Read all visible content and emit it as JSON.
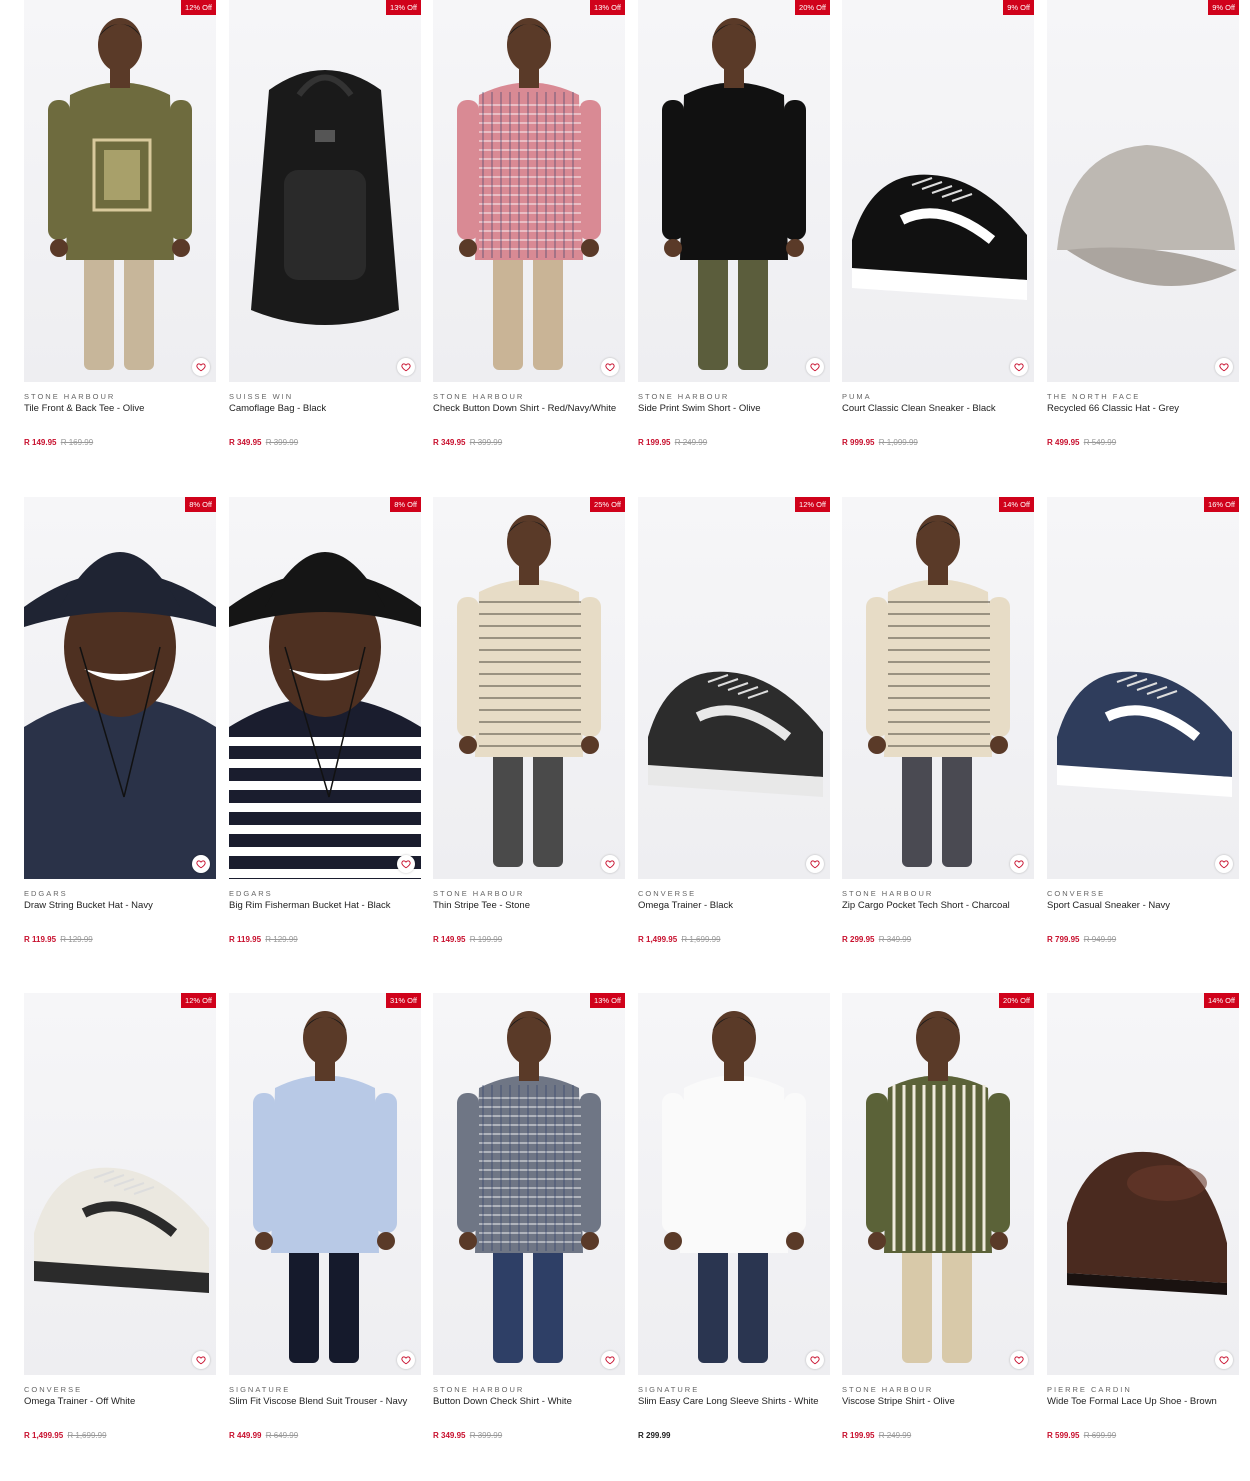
{
  "products": [
    {
      "badge": "12% Off",
      "brand": "STONE HARBOUR",
      "name": "Tile Front & Back Tee - Olive",
      "price": "R 149.95",
      "was": "R 169.99",
      "kind": "person",
      "top": "#6e6b3e",
      "bottom": "#c7b69a",
      "skin": "#5a3a28",
      "pattern": "graphic"
    },
    {
      "badge": "13% Off",
      "brand": "SUISSE WIN",
      "name": "Camoflage Bag - Black",
      "price": "R 349.95",
      "was": "R 399.99",
      "kind": "bag",
      "color": "#1a1a1a"
    },
    {
      "badge": "13% Off",
      "brand": "STONE HARBOUR",
      "name": "Check Button Down Shirt - Red/Navy/White",
      "price": "R 349.95",
      "was": "R 399.99",
      "kind": "person",
      "top": "#d98a94",
      "bottom": "#c9b496",
      "skin": "#5a3a28",
      "pattern": "check"
    },
    {
      "badge": "20% Off",
      "brand": "STONE HARBOUR",
      "name": "Side Print Swim Short - Olive",
      "price": "R 199.95",
      "was": "R 249.99",
      "kind": "person",
      "top": "#111111",
      "bottom": "#5b5d3c",
      "skin": "#5a3a28",
      "pattern": "plain"
    },
    {
      "badge": "9% Off",
      "brand": "PUMA",
      "name": "Court Classic Clean Sneaker - Black",
      "price": "R 999.95",
      "was": "R 1,099.99",
      "kind": "shoe",
      "color": "#111111",
      "accent": "#ffffff"
    },
    {
      "badge": "9% Off",
      "brand": "THE NORTH FACE",
      "name": "Recycled 66 Classic Hat - Grey",
      "price": "R 499.95",
      "was": "R 549.99",
      "kind": "cap",
      "color": "#bdb8b2"
    },
    {
      "badge": "8% Off",
      "brand": "EDGARS",
      "name": "Draw String Bucket Hat - Navy",
      "price": "R 119.95",
      "was": "R 129.99",
      "kind": "portrait",
      "hat": "#1f2433",
      "top": "#2a3248",
      "skin": "#4e3021"
    },
    {
      "badge": "8% Off",
      "brand": "EDGARS",
      "name": "Big Rim Fisherman Bucket Hat - Black",
      "price": "R 119.95",
      "was": "R 129.99",
      "kind": "portrait",
      "hat": "#151515",
      "top": "#1a1d2e",
      "skin": "#4e3021",
      "stripes": true
    },
    {
      "badge": "25% Off",
      "brand": "STONE HARBOUR",
      "name": "Thin Stripe Tee - Stone",
      "price": "R 149.95",
      "was": "R 199.99",
      "kind": "person",
      "top": "#e7dcc6",
      "bottom": "#4a4a4a",
      "skin": "#5a3a28",
      "pattern": "stripe"
    },
    {
      "badge": "12% Off",
      "brand": "CONVERSE",
      "name": "Omega Trainer - Black",
      "price": "R 1,499.95",
      "was": "R 1,699.99",
      "kind": "shoe",
      "color": "#2c2c2c",
      "accent": "#e8e8e8"
    },
    {
      "badge": "14% Off",
      "brand": "STONE HARBOUR",
      "name": "Zip Cargo Pocket Tech Short - Charcoal",
      "price": "R 299.95",
      "was": "R 349.99",
      "kind": "person",
      "top": "#e7dcc6",
      "bottom": "#4a4a52",
      "skin": "#5a3a28",
      "pattern": "stripe"
    },
    {
      "badge": "16% Off",
      "brand": "CONVERSE",
      "name": "Sport Casual Sneaker - Navy",
      "price": "R 799.95",
      "was": "R 949.99",
      "kind": "shoe",
      "color": "#2f3d5c",
      "accent": "#ffffff"
    },
    {
      "badge": "12% Off",
      "brand": "CONVERSE",
      "name": "Omega Trainer - Off White",
      "price": "R 1,499.95",
      "was": "R 1,699.99",
      "kind": "shoe",
      "color": "#ebe8e0",
      "accent": "#2b2b2b"
    },
    {
      "badge": "31% Off",
      "brand": "SIGNATURE",
      "name": "Slim Fit Viscose Blend Suit Trouser - Navy",
      "price": "R 449.99",
      "was": "R 649.99",
      "kind": "person",
      "top": "#b8c9e6",
      "bottom": "#151a2c",
      "skin": "#5a3a28",
      "pattern": "plain"
    },
    {
      "badge": "13% Off",
      "brand": "STONE HARBOUR",
      "name": "Button Down Check Shirt - White",
      "price": "R 349.95",
      "was": "R 399.99",
      "kind": "person",
      "top": "#6f7685",
      "bottom": "#2e3f66",
      "skin": "#5a3a28",
      "pattern": "check"
    },
    {
      "badge": "",
      "brand": "SIGNATURE",
      "name": "Slim Easy Care Long Sleeve Shirts - White",
      "price": "R 299.99",
      "was": "",
      "kind": "person",
      "top": "#fafafa",
      "bottom": "#2a3550",
      "skin": "#5a3a28",
      "pattern": "plain"
    },
    {
      "badge": "20% Off",
      "brand": "STONE HARBOUR",
      "name": "Viscose Stripe Shirt - Olive",
      "price": "R 199.95",
      "was": "R 249.99",
      "kind": "person",
      "top": "#5b6238",
      "bottom": "#d8c9a9",
      "skin": "#5a3a28",
      "pattern": "vstripe"
    },
    {
      "badge": "14% Off",
      "brand": "PIERRE CARDIN",
      "name": "Wide Toe Formal Lace Up Shoe - Brown",
      "price": "R 599.95",
      "was": "R 699.99",
      "kind": "formal",
      "color": "#4a2a1f"
    }
  ],
  "icons": {
    "favourite": "heart-icon"
  },
  "colors": {
    "badge": "#d0021b",
    "sale_price": "#c8102e"
  }
}
